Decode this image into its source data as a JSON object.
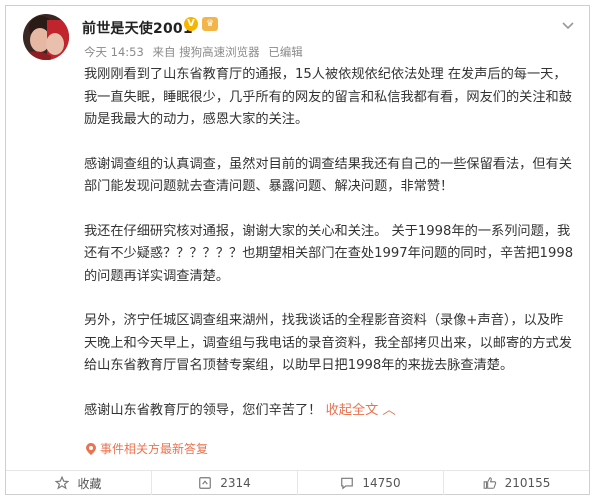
{
  "post": {
    "username": "前世是天使2001",
    "time": "今天 14:53",
    "source": "来自 搜狗高速浏览器",
    "edited": "已编辑",
    "paragraphs": [
      "我刚刚看到了山东省教育厅的通报，15人被依规依纪依法处理 在发声后的每一天，我一直失眠，睡眠很少，几乎所有的网友的留言和私信我都有看，网友们的关注和鼓励是我最大的动力，感恩大家的关注。",
      "感谢调查组的认真调查，虽然对目前的调查结果我还有自己的一些保留看法，但有关部门能发现问题就去查清问题、暴露问题、解决问题，非常赞！",
      "我还在仔细研究核对通报，谢谢大家的关心和关注。 关于1998年的一系列问题，我还有不少疑惑？？？？？？也期望相关部门在查处1997年问题的同时，辛苦把1998的问题再详实调查清楚。",
      "另外，济宁任城区调查组来湖州，找我谈话的全程影音资料（录像+声音），以及昨天晚上和今天早上，调查组与我电话的录音资料，我全部拷贝出来，以邮寄的方式发给山东省教育厅冒名顶替专案组，以助早日把1998年的来拢去脉查清楚。"
    ],
    "last_line": "感谢山东省教育厅的领导，您们辛苦了！",
    "collapse_link": "收起全文",
    "respond_label": "事件相关方最新答复"
  },
  "toolbar": {
    "favorite_label": "收藏",
    "repost_count": "2314",
    "comment_count": "14750",
    "like_count": "210155"
  },
  "colors": {
    "link": "#eb7350",
    "verified": "#f7b500"
  },
  "icons": [
    "chevron-down-icon",
    "verified-v-icon",
    "level-badge-icon",
    "star-icon",
    "repost-icon",
    "comment-icon",
    "like-icon",
    "pin-icon"
  ]
}
